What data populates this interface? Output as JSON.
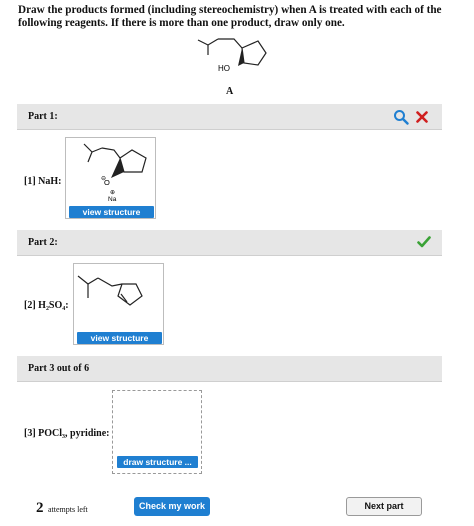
{
  "question": "Draw the products formed (including stereochemistry) when A is treated with each of the following reagents. If there is more than one product, draw only one.",
  "molecule": {
    "label": "A",
    "oh_label": "HO"
  },
  "part1": {
    "header": "Part 1:",
    "reagent": "[1] NaH:",
    "na_label": "Na",
    "o_label": "O",
    "neg_charge": "⊖",
    "pos_charge": "⊕",
    "button": "view structure",
    "status_icons": [
      "magnifier-icon",
      "x-icon"
    ],
    "colors": {
      "magnifier": "#1f7fd1",
      "x": "#d01f1f"
    }
  },
  "part2": {
    "header": "Part 2:",
    "reagent": "[2] H₂SO₄:",
    "button": "view structure",
    "status_icons": [
      "checkmark-icon"
    ],
    "colors": {
      "check": "#3aa236"
    }
  },
  "part3": {
    "header": "Part 3 out of 6",
    "reagent": "[3] POCl₃, pyridine:",
    "button": "draw structure ..."
  },
  "footer": {
    "attempts_number": "2",
    "attempts_text": "attempts left",
    "check_button": "Check my work",
    "next_button": "Next part"
  }
}
